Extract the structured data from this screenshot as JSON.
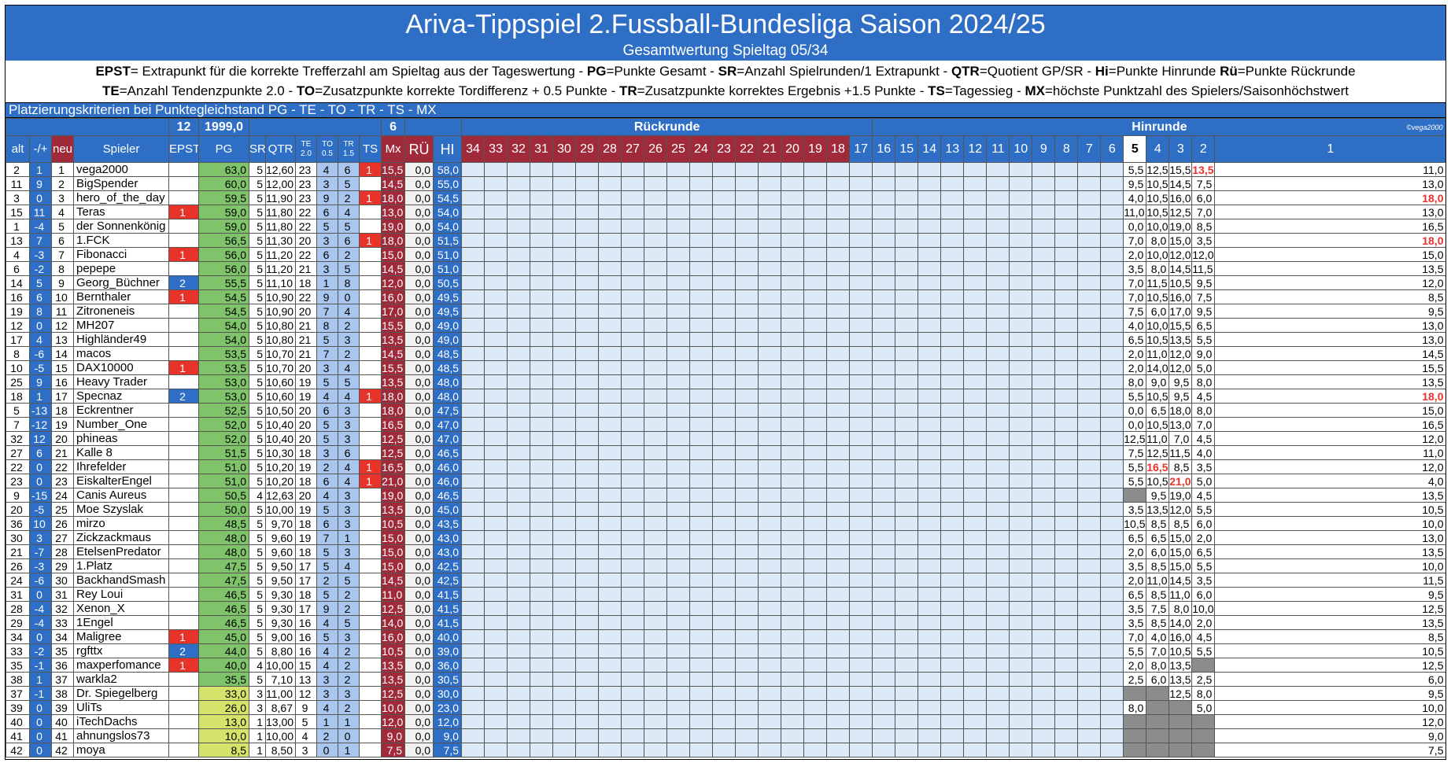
{
  "title": "Ariva-Tippspiel 2.Fussball-Bundesliga Saison 2024/25",
  "subtitle": "Gesamtwertung Spieltag 05/34",
  "legend_line1": [
    {
      "k": "EPST",
      "v": "= Extrapunkt für die korrekte Trefferzahl am Spieltag aus der Tageswertung - "
    },
    {
      "k": "PG",
      "v": "=Punkte Gesamt - "
    },
    {
      "k": "SR",
      "v": "=Anzahl Spielrunden/1 Extrapunkt - "
    },
    {
      "k": "QTR",
      "v": "=Quotient GP/SR - "
    },
    {
      "k": "Hi",
      "v": "=Punkte Hinrunde  "
    },
    {
      "k": "Rü",
      "v": "=Punkte Rückrunde"
    }
  ],
  "legend_line2": [
    {
      "k": "TE",
      "v": "=Anzahl Tendenzpunkte 2.0 - "
    },
    {
      "k": "TO",
      "v": "=Zusatzpunkte korrekte Tordifferenz + 0.5 Punkte - "
    },
    {
      "k": "TR",
      "v": "=Zusatzpunkte korrektes Ergebnis +1.5 Punkte - "
    },
    {
      "k": "TS",
      "v": "=Tagessieg - "
    },
    {
      "k": "MX",
      "v": "=höchste Punktzahl des Spielers/Saisonhöchstwert"
    }
  ],
  "criteria": "Platzierungskriterien bei Punktegleichstand  PG - TE - TO - TR - TS - MX",
  "totals": {
    "epst": "12",
    "pg": "1999,0",
    "ts": "6"
  },
  "section_rueckrunde": "Rückrunde",
  "section_hinrunde": "Hinrunde",
  "copyright": "©vega2000",
  "columns": {
    "alt": "alt",
    "diff": "-/+",
    "neu": "neu",
    "spieler": "Spieler",
    "epst": "EPST",
    "pg": "PG",
    "sr": "SR",
    "qtr": "QTR",
    "te": "TE",
    "te_sub": "2.0",
    "to": "TO",
    "to_sub": "0.5",
    "tr": "TR",
    "tr_sub": "1.5",
    "ts": "TS",
    "mx": "Mx",
    "ru": "RÜ",
    "hi": "HI"
  },
  "rueck_days": [
    "34",
    "33",
    "32",
    "31",
    "30",
    "29",
    "28",
    "27",
    "26",
    "25",
    "24",
    "23",
    "22",
    "21",
    "20",
    "19",
    "18"
  ],
  "hin_days": [
    "17",
    "16",
    "15",
    "14",
    "13",
    "12",
    "11",
    "10",
    "9",
    "8",
    "7",
    "6",
    "5",
    "4",
    "3",
    "2",
    "1"
  ],
  "rows": [
    {
      "alt": "2",
      "diff": "1",
      "neu": "1",
      "name": "vega2000",
      "epst": "",
      "pg": "63,0",
      "sr": "5",
      "qtr": "12,60",
      "te": "23",
      "to": "4",
      "tr": "6",
      "ts": "1",
      "mx": "15,5",
      "ru": "0,0",
      "hi": "58,0",
      "d5": "5,5",
      "d4": "12,5",
      "d3": "15,5",
      "d2": "13,5",
      "d1": "11,0",
      "hot": [
        "d2"
      ]
    },
    {
      "alt": "11",
      "diff": "9",
      "neu": "2",
      "name": "BigSpender",
      "epst": "",
      "pg": "60,0",
      "sr": "5",
      "qtr": "12,00",
      "te": "23",
      "to": "3",
      "tr": "5",
      "ts": "",
      "mx": "14,5",
      "ru": "0,0",
      "hi": "55,0",
      "d5": "9,5",
      "d4": "10,5",
      "d3": "14,5",
      "d2": "7,5",
      "d1": "13,0"
    },
    {
      "alt": "3",
      "diff": "0",
      "neu": "3",
      "name": "hero_of_the_day",
      "epst": "",
      "pg": "59,5",
      "sr": "5",
      "qtr": "11,90",
      "te": "23",
      "to": "9",
      "tr": "2",
      "ts": "1",
      "mx": "18,0",
      "ru": "0,0",
      "hi": "54,5",
      "d5": "4,0",
      "d4": "10,5",
      "d3": "16,0",
      "d2": "6,0",
      "d1": "18,0",
      "hot": [
        "d1"
      ]
    },
    {
      "alt": "15",
      "diff": "11",
      "neu": "4",
      "name": "Teras",
      "epst": "1",
      "epc": "red",
      "pg": "59,0",
      "sr": "5",
      "qtr": "11,80",
      "te": "22",
      "to": "6",
      "tr": "4",
      "ts": "",
      "mx": "13,0",
      "ru": "0,0",
      "hi": "54,0",
      "d5": "11,0",
      "d4": "10,5",
      "d3": "12,5",
      "d2": "7,0",
      "d1": "13,0"
    },
    {
      "alt": "1",
      "diff": "-4",
      "neu": "5",
      "name": "der Sonnenkönig",
      "epst": "",
      "pg": "59,0",
      "sr": "5",
      "qtr": "11,80",
      "te": "22",
      "to": "5",
      "tr": "5",
      "ts": "",
      "mx": "19,0",
      "ru": "0,0",
      "hi": "54,0",
      "d5": "0,0",
      "d4": "10,0",
      "d3": "19,0",
      "d2": "8,5",
      "d1": "16,5"
    },
    {
      "alt": "13",
      "diff": "7",
      "neu": "6",
      "name": "1.FCK",
      "epst": "",
      "pg": "56,5",
      "sr": "5",
      "qtr": "11,30",
      "te": "20",
      "to": "3",
      "tr": "6",
      "ts": "1",
      "mx": "18,0",
      "ru": "0,0",
      "hi": "51,5",
      "d5": "7,0",
      "d4": "8,0",
      "d3": "15,0",
      "d2": "3,5",
      "d1": "18,0",
      "hot": [
        "d1"
      ]
    },
    {
      "alt": "4",
      "diff": "-3",
      "neu": "7",
      "name": "Fibonacci",
      "epst": "1",
      "epc": "red",
      "pg": "56,0",
      "sr": "5",
      "qtr": "11,20",
      "te": "22",
      "to": "6",
      "tr": "2",
      "ts": "",
      "mx": "15,0",
      "ru": "0,0",
      "hi": "51,0",
      "d5": "2,0",
      "d4": "10,0",
      "d3": "12,0",
      "d2": "12,0",
      "d1": "15,0"
    },
    {
      "alt": "6",
      "diff": "-2",
      "neu": "8",
      "name": "pepepe",
      "epst": "",
      "pg": "56,0",
      "sr": "5",
      "qtr": "11,20",
      "te": "21",
      "to": "3",
      "tr": "5",
      "ts": "",
      "mx": "14,5",
      "ru": "0,0",
      "hi": "51,0",
      "d5": "3,5",
      "d4": "8,0",
      "d3": "14,5",
      "d2": "11,5",
      "d1": "13,5"
    },
    {
      "alt": "14",
      "diff": "5",
      "neu": "9",
      "name": "Georg_Büchner",
      "epst": "2",
      "epc": "blue",
      "pg": "55,5",
      "sr": "5",
      "qtr": "11,10",
      "te": "18",
      "to": "1",
      "tr": "8",
      "ts": "",
      "mx": "12,0",
      "ru": "0,0",
      "hi": "50,5",
      "d5": "7,0",
      "d4": "11,5",
      "d3": "10,5",
      "d2": "9,5",
      "d1": "12,0"
    },
    {
      "alt": "16",
      "diff": "6",
      "neu": "10",
      "name": "Bernthaler",
      "epst": "1",
      "epc": "red",
      "pg": "54,5",
      "sr": "5",
      "qtr": "10,90",
      "te": "22",
      "to": "9",
      "tr": "0",
      "ts": "",
      "mx": "16,0",
      "ru": "0,0",
      "hi": "49,5",
      "d5": "7,0",
      "d4": "10,5",
      "d3": "16,0",
      "d2": "7,5",
      "d1": "8,5"
    },
    {
      "alt": "19",
      "diff": "8",
      "neu": "11",
      "name": "Zitroneneis",
      "epst": "",
      "pg": "54,5",
      "sr": "5",
      "qtr": "10,90",
      "te": "20",
      "to": "7",
      "tr": "4",
      "ts": "",
      "mx": "17,0",
      "ru": "0,0",
      "hi": "49,5",
      "d5": "7,5",
      "d4": "6,0",
      "d3": "17,0",
      "d2": "9,5",
      "d1": "9,5"
    },
    {
      "alt": "12",
      "diff": "0",
      "neu": "12",
      "name": "MH207",
      "epst": "",
      "pg": "54,0",
      "sr": "5",
      "qtr": "10,80",
      "te": "21",
      "to": "8",
      "tr": "2",
      "ts": "",
      "mx": "15,5",
      "ru": "0,0",
      "hi": "49,0",
      "d5": "4,0",
      "d4": "10,0",
      "d3": "15,5",
      "d2": "6,5",
      "d1": "13,0"
    },
    {
      "alt": "17",
      "diff": "4",
      "neu": "13",
      "name": "Highländer49",
      "epst": "",
      "pg": "54,0",
      "sr": "5",
      "qtr": "10,80",
      "te": "21",
      "to": "5",
      "tr": "3",
      "ts": "",
      "mx": "13,5",
      "ru": "0,0",
      "hi": "49,0",
      "d5": "6,5",
      "d4": "10,5",
      "d3": "13,5",
      "d2": "5,5",
      "d1": "13,0"
    },
    {
      "alt": "8",
      "diff": "-6",
      "neu": "14",
      "name": "macos",
      "epst": "",
      "pg": "53,5",
      "sr": "5",
      "qtr": "10,70",
      "te": "21",
      "to": "7",
      "tr": "2",
      "ts": "",
      "mx": "14,5",
      "ru": "0,0",
      "hi": "48,5",
      "d5": "2,0",
      "d4": "11,0",
      "d3": "12,0",
      "d2": "9,0",
      "d1": "14,5"
    },
    {
      "alt": "10",
      "diff": "-5",
      "neu": "15",
      "name": "DAX10000",
      "epst": "1",
      "epc": "red",
      "pg": "53,5",
      "sr": "5",
      "qtr": "10,70",
      "te": "20",
      "to": "3",
      "tr": "4",
      "ts": "",
      "mx": "15,5",
      "ru": "0,0",
      "hi": "48,5",
      "d5": "2,0",
      "d4": "14,0",
      "d3": "12,0",
      "d2": "5,0",
      "d1": "15,5"
    },
    {
      "alt": "25",
      "diff": "9",
      "neu": "16",
      "name": "Heavy Trader",
      "epst": "",
      "pg": "53,0",
      "sr": "5",
      "qtr": "10,60",
      "te": "19",
      "to": "5",
      "tr": "5",
      "ts": "",
      "mx": "13,5",
      "ru": "0,0",
      "hi": "48,0",
      "d5": "8,0",
      "d4": "9,0",
      "d3": "9,5",
      "d2": "8,0",
      "d1": "13,5"
    },
    {
      "alt": "18",
      "diff": "1",
      "neu": "17",
      "name": "Specnaz",
      "epst": "2",
      "epc": "blue",
      "pg": "53,0",
      "sr": "5",
      "qtr": "10,60",
      "te": "19",
      "to": "4",
      "tr": "4",
      "ts": "1",
      "mx": "18,0",
      "ru": "0,0",
      "hi": "48,0",
      "d5": "5,5",
      "d4": "10,5",
      "d3": "9,5",
      "d2": "4,5",
      "d1": "18,0",
      "hot": [
        "d1"
      ]
    },
    {
      "alt": "5",
      "diff": "-13",
      "neu": "18",
      "name": "Eckrentner",
      "epst": "",
      "pg": "52,5",
      "sr": "5",
      "qtr": "10,50",
      "te": "20",
      "to": "6",
      "tr": "3",
      "ts": "",
      "mx": "18,0",
      "ru": "0,0",
      "hi": "47,5",
      "d5": "0,0",
      "d4": "6,5",
      "d3": "18,0",
      "d2": "8,0",
      "d1": "15,0"
    },
    {
      "alt": "7",
      "diff": "-12",
      "neu": "19",
      "name": "Number_One",
      "epst": "",
      "pg": "52,0",
      "sr": "5",
      "qtr": "10,40",
      "te": "20",
      "to": "5",
      "tr": "3",
      "ts": "",
      "mx": "16,5",
      "ru": "0,0",
      "hi": "47,0",
      "d5": "0,0",
      "d4": "10,5",
      "d3": "13,0",
      "d2": "7,0",
      "d1": "16,5"
    },
    {
      "alt": "32",
      "diff": "12",
      "neu": "20",
      "name": "phineas",
      "epst": "",
      "pg": "52,0",
      "sr": "5",
      "qtr": "10,40",
      "te": "20",
      "to": "5",
      "tr": "3",
      "ts": "",
      "mx": "12,5",
      "ru": "0,0",
      "hi": "47,0",
      "d5": "12,5",
      "d4": "11,0",
      "d3": "7,0",
      "d2": "4,5",
      "d1": "12,0"
    },
    {
      "alt": "27",
      "diff": "6",
      "neu": "21",
      "name": "Kalle 8",
      "epst": "",
      "pg": "51,5",
      "sr": "5",
      "qtr": "10,30",
      "te": "18",
      "to": "3",
      "tr": "6",
      "ts": "",
      "mx": "12,5",
      "ru": "0,0",
      "hi": "46,5",
      "d5": "7,5",
      "d4": "12,5",
      "d3": "11,5",
      "d2": "4,0",
      "d1": "11,0"
    },
    {
      "alt": "22",
      "diff": "0",
      "neu": "22",
      "name": "Ihrefelder",
      "epst": "",
      "pg": "51,0",
      "sr": "5",
      "qtr": "10,20",
      "te": "19",
      "to": "2",
      "tr": "4",
      "ts": "1",
      "mx": "16,5",
      "ru": "0,0",
      "hi": "46,0",
      "d5": "5,5",
      "d4": "16,5",
      "d3": "8,5",
      "d2": "3,5",
      "d1": "12,0",
      "hot": [
        "d4"
      ]
    },
    {
      "alt": "23",
      "diff": "0",
      "neu": "23",
      "name": "EiskalterEngel",
      "epst": "",
      "pg": "51,0",
      "sr": "5",
      "qtr": "10,20",
      "te": "18",
      "to": "6",
      "tr": "4",
      "ts": "1",
      "mx": "21,0",
      "ru": "0,0",
      "hi": "46,0",
      "d5": "5,5",
      "d4": "10,5",
      "d3": "21,0",
      "d2": "5,0",
      "d1": "4,0",
      "hot": [
        "d3"
      ]
    },
    {
      "alt": "9",
      "diff": "-15",
      "neu": "24",
      "name": "Canis Aureus",
      "epst": "",
      "pg": "50,5",
      "sr": "4",
      "qtr": "12,63",
      "te": "20",
      "to": "4",
      "tr": "3",
      "ts": "",
      "mx": "19,0",
      "ru": "0,0",
      "hi": "46,5",
      "d5": "",
      "d4": "9,5",
      "d3": "19,0",
      "d2": "4,5",
      "d1": "13,5",
      "grey": [
        "d5"
      ]
    },
    {
      "alt": "20",
      "diff": "-5",
      "neu": "25",
      "name": "Moe Szyslak",
      "epst": "",
      "pg": "50,0",
      "sr": "5",
      "qtr": "10,00",
      "te": "19",
      "to": "5",
      "tr": "3",
      "ts": "",
      "mx": "13,5",
      "ru": "0,0",
      "hi": "45,0",
      "d5": "3,5",
      "d4": "13,5",
      "d3": "12,0",
      "d2": "5,5",
      "d1": "10,5"
    },
    {
      "alt": "36",
      "diff": "10",
      "neu": "26",
      "name": "mirzo",
      "epst": "",
      "pg": "48,5",
      "sr": "5",
      "qtr": "9,70",
      "te": "18",
      "to": "6",
      "tr": "3",
      "ts": "",
      "mx": "10,5",
      "ru": "0,0",
      "hi": "43,5",
      "d5": "10,5",
      "d4": "8,5",
      "d3": "8,5",
      "d2": "6,0",
      "d1": "10,0"
    },
    {
      "alt": "30",
      "diff": "3",
      "neu": "27",
      "name": "Zickzackmaus",
      "epst": "",
      "pg": "48,0",
      "sr": "5",
      "qtr": "9,60",
      "te": "19",
      "to": "7",
      "tr": "1",
      "ts": "",
      "mx": "15,0",
      "ru": "0,0",
      "hi": "43,0",
      "d5": "6,5",
      "d4": "6,5",
      "d3": "15,0",
      "d2": "2,0",
      "d1": "13,0"
    },
    {
      "alt": "21",
      "diff": "-7",
      "neu": "28",
      "name": "EtelsenPredator",
      "epst": "",
      "pg": "48,0",
      "sr": "5",
      "qtr": "9,60",
      "te": "18",
      "to": "5",
      "tr": "3",
      "ts": "",
      "mx": "15,0",
      "ru": "0,0",
      "hi": "43,0",
      "d5": "2,0",
      "d4": "6,0",
      "d3": "15,0",
      "d2": "6,5",
      "d1": "13,5"
    },
    {
      "alt": "26",
      "diff": "-3",
      "neu": "29",
      "name": "1.Platz",
      "epst": "",
      "pg": "47,5",
      "sr": "5",
      "qtr": "9,50",
      "te": "17",
      "to": "5",
      "tr": "4",
      "ts": "",
      "mx": "15,0",
      "ru": "0,0",
      "hi": "42,5",
      "d5": "3,5",
      "d4": "8,5",
      "d3": "15,0",
      "d2": "5,5",
      "d1": "10,0"
    },
    {
      "alt": "24",
      "diff": "-6",
      "neu": "30",
      "name": "BackhandSmash",
      "epst": "",
      "pg": "47,5",
      "sr": "5",
      "qtr": "9,50",
      "te": "17",
      "to": "2",
      "tr": "5",
      "ts": "",
      "mx": "14,5",
      "ru": "0,0",
      "hi": "42,5",
      "d5": "2,0",
      "d4": "11,0",
      "d3": "14,5",
      "d2": "3,5",
      "d1": "11,5"
    },
    {
      "alt": "31",
      "diff": "0",
      "neu": "31",
      "name": "Rey Loui",
      "epst": "",
      "pg": "46,5",
      "sr": "5",
      "qtr": "9,30",
      "te": "18",
      "to": "5",
      "tr": "2",
      "ts": "",
      "mx": "11,0",
      "ru": "0,0",
      "hi": "41,5",
      "d5": "6,5",
      "d4": "8,5",
      "d3": "11,0",
      "d2": "6,0",
      "d1": "9,5"
    },
    {
      "alt": "28",
      "diff": "-4",
      "neu": "32",
      "name": "Xenon_X",
      "epst": "",
      "pg": "46,5",
      "sr": "5",
      "qtr": "9,30",
      "te": "17",
      "to": "9",
      "tr": "2",
      "ts": "",
      "mx": "12,5",
      "ru": "0,0",
      "hi": "41,5",
      "d5": "3,5",
      "d4": "7,5",
      "d3": "8,0",
      "d2": "10,0",
      "d1": "12,5"
    },
    {
      "alt": "29",
      "diff": "-4",
      "neu": "33",
      "name": "1Engel",
      "epst": "",
      "pg": "46,5",
      "sr": "5",
      "qtr": "9,30",
      "te": "16",
      "to": "4",
      "tr": "5",
      "ts": "",
      "mx": "14,0",
      "ru": "0,0",
      "hi": "41,5",
      "d5": "3,5",
      "d4": "8,5",
      "d3": "14,0",
      "d2": "2,0",
      "d1": "13,5"
    },
    {
      "alt": "34",
      "diff": "0",
      "neu": "34",
      "name": "Maligree",
      "epst": "1",
      "epc": "red",
      "pg": "45,0",
      "sr": "5",
      "qtr": "9,00",
      "te": "16",
      "to": "5",
      "tr": "3",
      "ts": "",
      "mx": "16,0",
      "ru": "0,0",
      "hi": "40,0",
      "d5": "7,0",
      "d4": "4,0",
      "d3": "16,0",
      "d2": "4,5",
      "d1": "8,5"
    },
    {
      "alt": "33",
      "diff": "-2",
      "neu": "35",
      "name": "rgfttx",
      "epst": "2",
      "epc": "blue",
      "pg": "44,0",
      "sr": "5",
      "qtr": "8,80",
      "te": "16",
      "to": "4",
      "tr": "2",
      "ts": "",
      "mx": "10,5",
      "ru": "0,0",
      "hi": "39,0",
      "d5": "5,5",
      "d4": "7,0",
      "d3": "10,5",
      "d2": "5,5",
      "d1": "10,5"
    },
    {
      "alt": "35",
      "diff": "-1",
      "neu": "36",
      "name": "maxperfomance",
      "epst": "1",
      "epc": "red",
      "pg": "40,0",
      "sr": "4",
      "qtr": "10,00",
      "te": "15",
      "to": "4",
      "tr": "2",
      "ts": "",
      "mx": "13,5",
      "ru": "0,0",
      "hi": "36,0",
      "d5": "2,0",
      "d4": "8,0",
      "d3": "13,5",
      "d2": "",
      "d1": "12,5",
      "grey": [
        "d2"
      ]
    },
    {
      "alt": "38",
      "diff": "1",
      "neu": "37",
      "name": "warkla2",
      "epst": "",
      "pg": "35,5",
      "sr": "5",
      "qtr": "7,10",
      "te": "13",
      "to": "3",
      "tr": "2",
      "ts": "",
      "mx": "13,5",
      "ru": "0,0",
      "hi": "30,5",
      "d5": "2,5",
      "d4": "6,0",
      "d3": "13,5",
      "d2": "2,5",
      "d1": "6,0"
    },
    {
      "alt": "37",
      "diff": "-1",
      "neu": "38",
      "name": "Dr. Spiegelberg",
      "epst": "",
      "pg": "33,0",
      "sr": "3",
      "qtr": "11,00",
      "te": "12",
      "to": "3",
      "tr": "3",
      "ts": "",
      "mx": "12,5",
      "ru": "0,0",
      "hi": "30,0",
      "d5": "",
      "d4": "",
      "d3": "12,5",
      "d2": "8,0",
      "d1": "9,5",
      "grey": [
        "d5",
        "d4"
      ]
    },
    {
      "alt": "39",
      "diff": "0",
      "neu": "39",
      "name": "UliTs",
      "epst": "",
      "pg": "26,0",
      "sr": "3",
      "qtr": "8,67",
      "te": "9",
      "to": "4",
      "tr": "2",
      "ts": "",
      "mx": "10,0",
      "ru": "0,0",
      "hi": "23,0",
      "d5": "8,0",
      "d4": "",
      "d3": "",
      "d2": "5,0",
      "d1": "10,0",
      "grey": [
        "d4",
        "d3"
      ]
    },
    {
      "alt": "40",
      "diff": "0",
      "neu": "40",
      "name": "iTechDachs",
      "epst": "",
      "pg": "13,0",
      "sr": "1",
      "qtr": "13,00",
      "te": "5",
      "to": "1",
      "tr": "1",
      "ts": "",
      "mx": "12,0",
      "ru": "0,0",
      "hi": "12,0",
      "d5": "",
      "d4": "",
      "d3": "",
      "d2": "",
      "d1": "12,0",
      "grey": [
        "d5",
        "d4",
        "d3",
        "d2"
      ]
    },
    {
      "alt": "41",
      "diff": "0",
      "neu": "41",
      "name": "ahnungslos73",
      "epst": "",
      "pg": "10,0",
      "sr": "1",
      "qtr": "10,00",
      "te": "4",
      "to": "2",
      "tr": "0",
      "ts": "",
      "mx": "9,0",
      "ru": "0,0",
      "hi": "9,0",
      "d5": "",
      "d4": "",
      "d3": "",
      "d2": "",
      "d1": "9,0",
      "grey": [
        "d5",
        "d4",
        "d3",
        "d2"
      ]
    },
    {
      "alt": "42",
      "diff": "0",
      "neu": "42",
      "name": "moya",
      "epst": "",
      "pg": "8,5",
      "sr": "1",
      "qtr": "8,50",
      "te": "3",
      "to": "0",
      "tr": "1",
      "ts": "",
      "mx": "7,5",
      "ru": "0,0",
      "hi": "7,5",
      "d5": "",
      "d4": "",
      "d3": "",
      "d2": "",
      "d1": "7,5",
      "grey": [
        "d5",
        "d4",
        "d3",
        "d2"
      ]
    }
  ],
  "colors": {
    "blue": "#2e6ec4",
    "maroon": "#a02a3a",
    "green": "#7fc46a",
    "red": "#e8332b",
    "lightblue": "#dce9f7",
    "grey": "#8c8c8c"
  }
}
